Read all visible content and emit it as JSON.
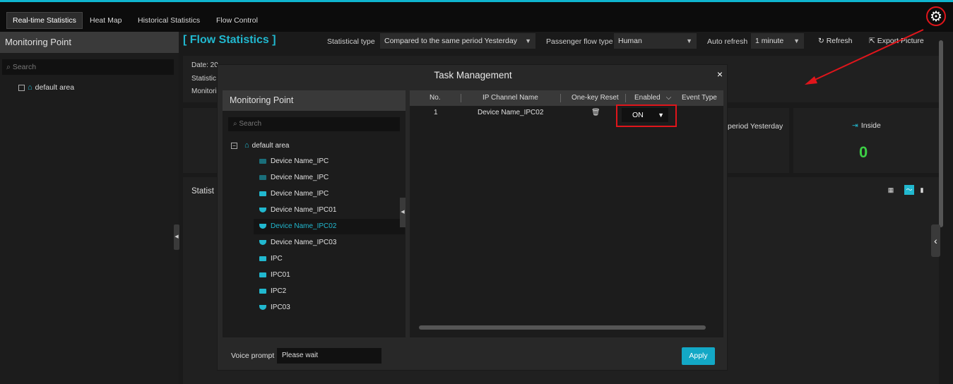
{
  "tabs": [
    "Real-time Statistics",
    "Heat Map",
    "Historical Statistics",
    "Flow Control"
  ],
  "left_panel": {
    "header": "Monitoring Point",
    "search_placeholder": "Search",
    "root_item": "default area"
  },
  "main": {
    "title": "[ Flow Statistics ]",
    "statistical_type_label": "Statistical type",
    "statistical_type_value": "Compared to the same period Yesterday",
    "passenger_flow_type_label": "Passenger flow type",
    "passenger_flow_type_value": "Human",
    "auto_refresh_label": "Auto refresh",
    "auto_refresh_value": "1 minute",
    "refresh_label": "Refresh",
    "export_label": "Export Picture",
    "info_date": "Date: 20",
    "info_statistical": "Statistic",
    "info_monitoring": "Monitori",
    "period_text": "period Yesterday",
    "inside_label": "Inside",
    "inside_value": "0",
    "statistics_label": "Statist"
  },
  "modal": {
    "title": "Task Management",
    "close": "×",
    "left_header": "Monitoring Point",
    "search_placeholder": "Search",
    "tree": [
      {
        "label": "default area",
        "kind": "root"
      },
      {
        "label": "Device Name_IPC",
        "kind": "cam-dim"
      },
      {
        "label": "Device Name_IPC",
        "kind": "cam-dim"
      },
      {
        "label": "Device Name_IPC",
        "kind": "cam"
      },
      {
        "label": "Device Name_IPC01",
        "kind": "dome"
      },
      {
        "label": "Device Name_IPC02",
        "kind": "dome",
        "selected": true
      },
      {
        "label": "Device Name_IPC03",
        "kind": "dome"
      },
      {
        "label": "IPC",
        "kind": "cam"
      },
      {
        "label": "IPC01",
        "kind": "cam"
      },
      {
        "label": "IPC2",
        "kind": "cam"
      },
      {
        "label": "IPC03",
        "kind": "dome"
      }
    ],
    "columns": [
      "No.",
      "IP Channel Name",
      "One-key Reset",
      "Enabled",
      "Event Type"
    ],
    "row": {
      "no": "1",
      "channel": "Device Name_IPC02",
      "enabled": "ON"
    },
    "voice_prompt_label": "Voice prompt",
    "voice_prompt_value": "Please wait",
    "apply_label": "Apply"
  },
  "colors": {
    "accent": "#21b8cf",
    "highlight": "#e0151b",
    "value_green": "#3ccf45"
  },
  "icons": [
    "gear-icon",
    "home-icon",
    "camera-icon",
    "dome-camera-icon",
    "trash-icon",
    "refresh-icon",
    "export-icon",
    "close-icon",
    "chevron-left-icon"
  ]
}
